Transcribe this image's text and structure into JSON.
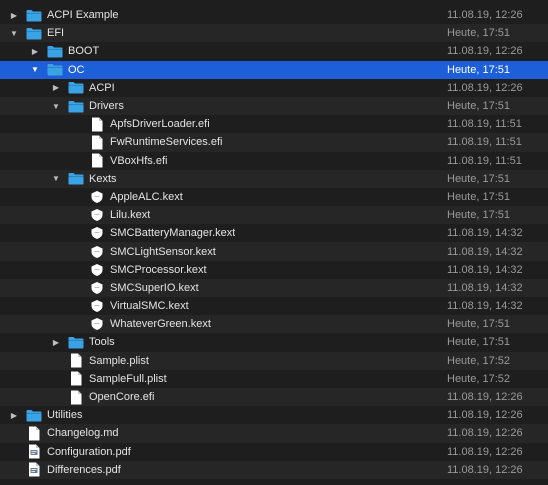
{
  "file_list": {
    "rows": [
      {
        "name": "ACPI Example",
        "date": "11.08.19, 12:26",
        "kind": "folder",
        "depth": 0,
        "disclosure": "collapsed"
      },
      {
        "name": "EFI",
        "date": "Heute, 17:51",
        "kind": "folder",
        "depth": 0,
        "disclosure": "expanded"
      },
      {
        "name": "BOOT",
        "date": "11.08.19, 12:26",
        "kind": "folder",
        "depth": 1,
        "disclosure": "collapsed"
      },
      {
        "name": "OC",
        "date": "Heute, 17:51",
        "kind": "folder",
        "depth": 1,
        "disclosure": "expanded",
        "selected": true
      },
      {
        "name": "ACPI",
        "date": "11.08.19, 12:26",
        "kind": "folder",
        "depth": 2,
        "disclosure": "collapsed"
      },
      {
        "name": "Drivers",
        "date": "Heute, 17:51",
        "kind": "folder",
        "depth": 2,
        "disclosure": "expanded"
      },
      {
        "name": "ApfsDriverLoader.efi",
        "date": "11.08.19, 11:51",
        "kind": "file",
        "depth": 3,
        "disclosure": "none"
      },
      {
        "name": "FwRuntimeServices.efi",
        "date": "11.08.19, 11:51",
        "kind": "file",
        "depth": 3,
        "disclosure": "none"
      },
      {
        "name": "VBoxHfs.efi",
        "date": "11.08.19, 11:51",
        "kind": "file",
        "depth": 3,
        "disclosure": "none"
      },
      {
        "name": "Kexts",
        "date": "Heute, 17:51",
        "kind": "folder",
        "depth": 2,
        "disclosure": "expanded"
      },
      {
        "name": "AppleALC.kext",
        "date": "Heute, 17:51",
        "kind": "kext",
        "depth": 3,
        "disclosure": "none"
      },
      {
        "name": "Lilu.kext",
        "date": "Heute, 17:51",
        "kind": "kext",
        "depth": 3,
        "disclosure": "none"
      },
      {
        "name": "SMCBatteryManager.kext",
        "date": "11.08.19, 14:32",
        "kind": "kext",
        "depth": 3,
        "disclosure": "none"
      },
      {
        "name": "SMCLightSensor.kext",
        "date": "11.08.19, 14:32",
        "kind": "kext",
        "depth": 3,
        "disclosure": "none"
      },
      {
        "name": "SMCProcessor.kext",
        "date": "11.08.19, 14:32",
        "kind": "kext",
        "depth": 3,
        "disclosure": "none"
      },
      {
        "name": "SMCSuperIO.kext",
        "date": "11.08.19, 14:32",
        "kind": "kext",
        "depth": 3,
        "disclosure": "none"
      },
      {
        "name": "VirtualSMC.kext",
        "date": "11.08.19, 14:32",
        "kind": "kext",
        "depth": 3,
        "disclosure": "none"
      },
      {
        "name": "WhateverGreen.kext",
        "date": "Heute, 17:51",
        "kind": "kext",
        "depth": 3,
        "disclosure": "none"
      },
      {
        "name": "Tools",
        "date": "Heute, 17:51",
        "kind": "folder",
        "depth": 2,
        "disclosure": "collapsed"
      },
      {
        "name": "Sample.plist",
        "date": "Heute, 17:52",
        "kind": "file",
        "depth": 2,
        "disclosure": "none"
      },
      {
        "name": "SampleFull.plist",
        "date": "Heute, 17:52",
        "kind": "file",
        "depth": 2,
        "disclosure": "none"
      },
      {
        "name": "OpenCore.efi",
        "date": "11.08.19, 12:26",
        "kind": "file",
        "depth": 2,
        "disclosure": "none"
      },
      {
        "name": "Utilities",
        "date": "11.08.19, 12:26",
        "kind": "folder",
        "depth": 0,
        "disclosure": "collapsed"
      },
      {
        "name": "Changelog.md",
        "date": "11.08.19, 12:26",
        "kind": "file",
        "depth": 0,
        "disclosure": "none"
      },
      {
        "name": "Configuration.pdf",
        "date": "11.08.19, 12:26",
        "kind": "pdf",
        "depth": 0,
        "disclosure": "none"
      },
      {
        "name": "Differences.pdf",
        "date": "11.08.19, 12:26",
        "kind": "pdf",
        "depth": 0,
        "disclosure": "none"
      }
    ]
  },
  "icons": {
    "folder": "folder-icon",
    "file": "document-icon",
    "kext": "kext-icon",
    "pdf": "pdf-document-icon",
    "collapsed": "disclosure-triangle-right-icon",
    "expanded": "disclosure-triangle-down-icon"
  },
  "colors": {
    "background": "#1e1e1e",
    "row_alt": "#262626",
    "selection": "#1d5fd8",
    "folder_blue": "#3aa3e6",
    "text": "#e4e4e4",
    "date_text": "#9a9a9a"
  }
}
